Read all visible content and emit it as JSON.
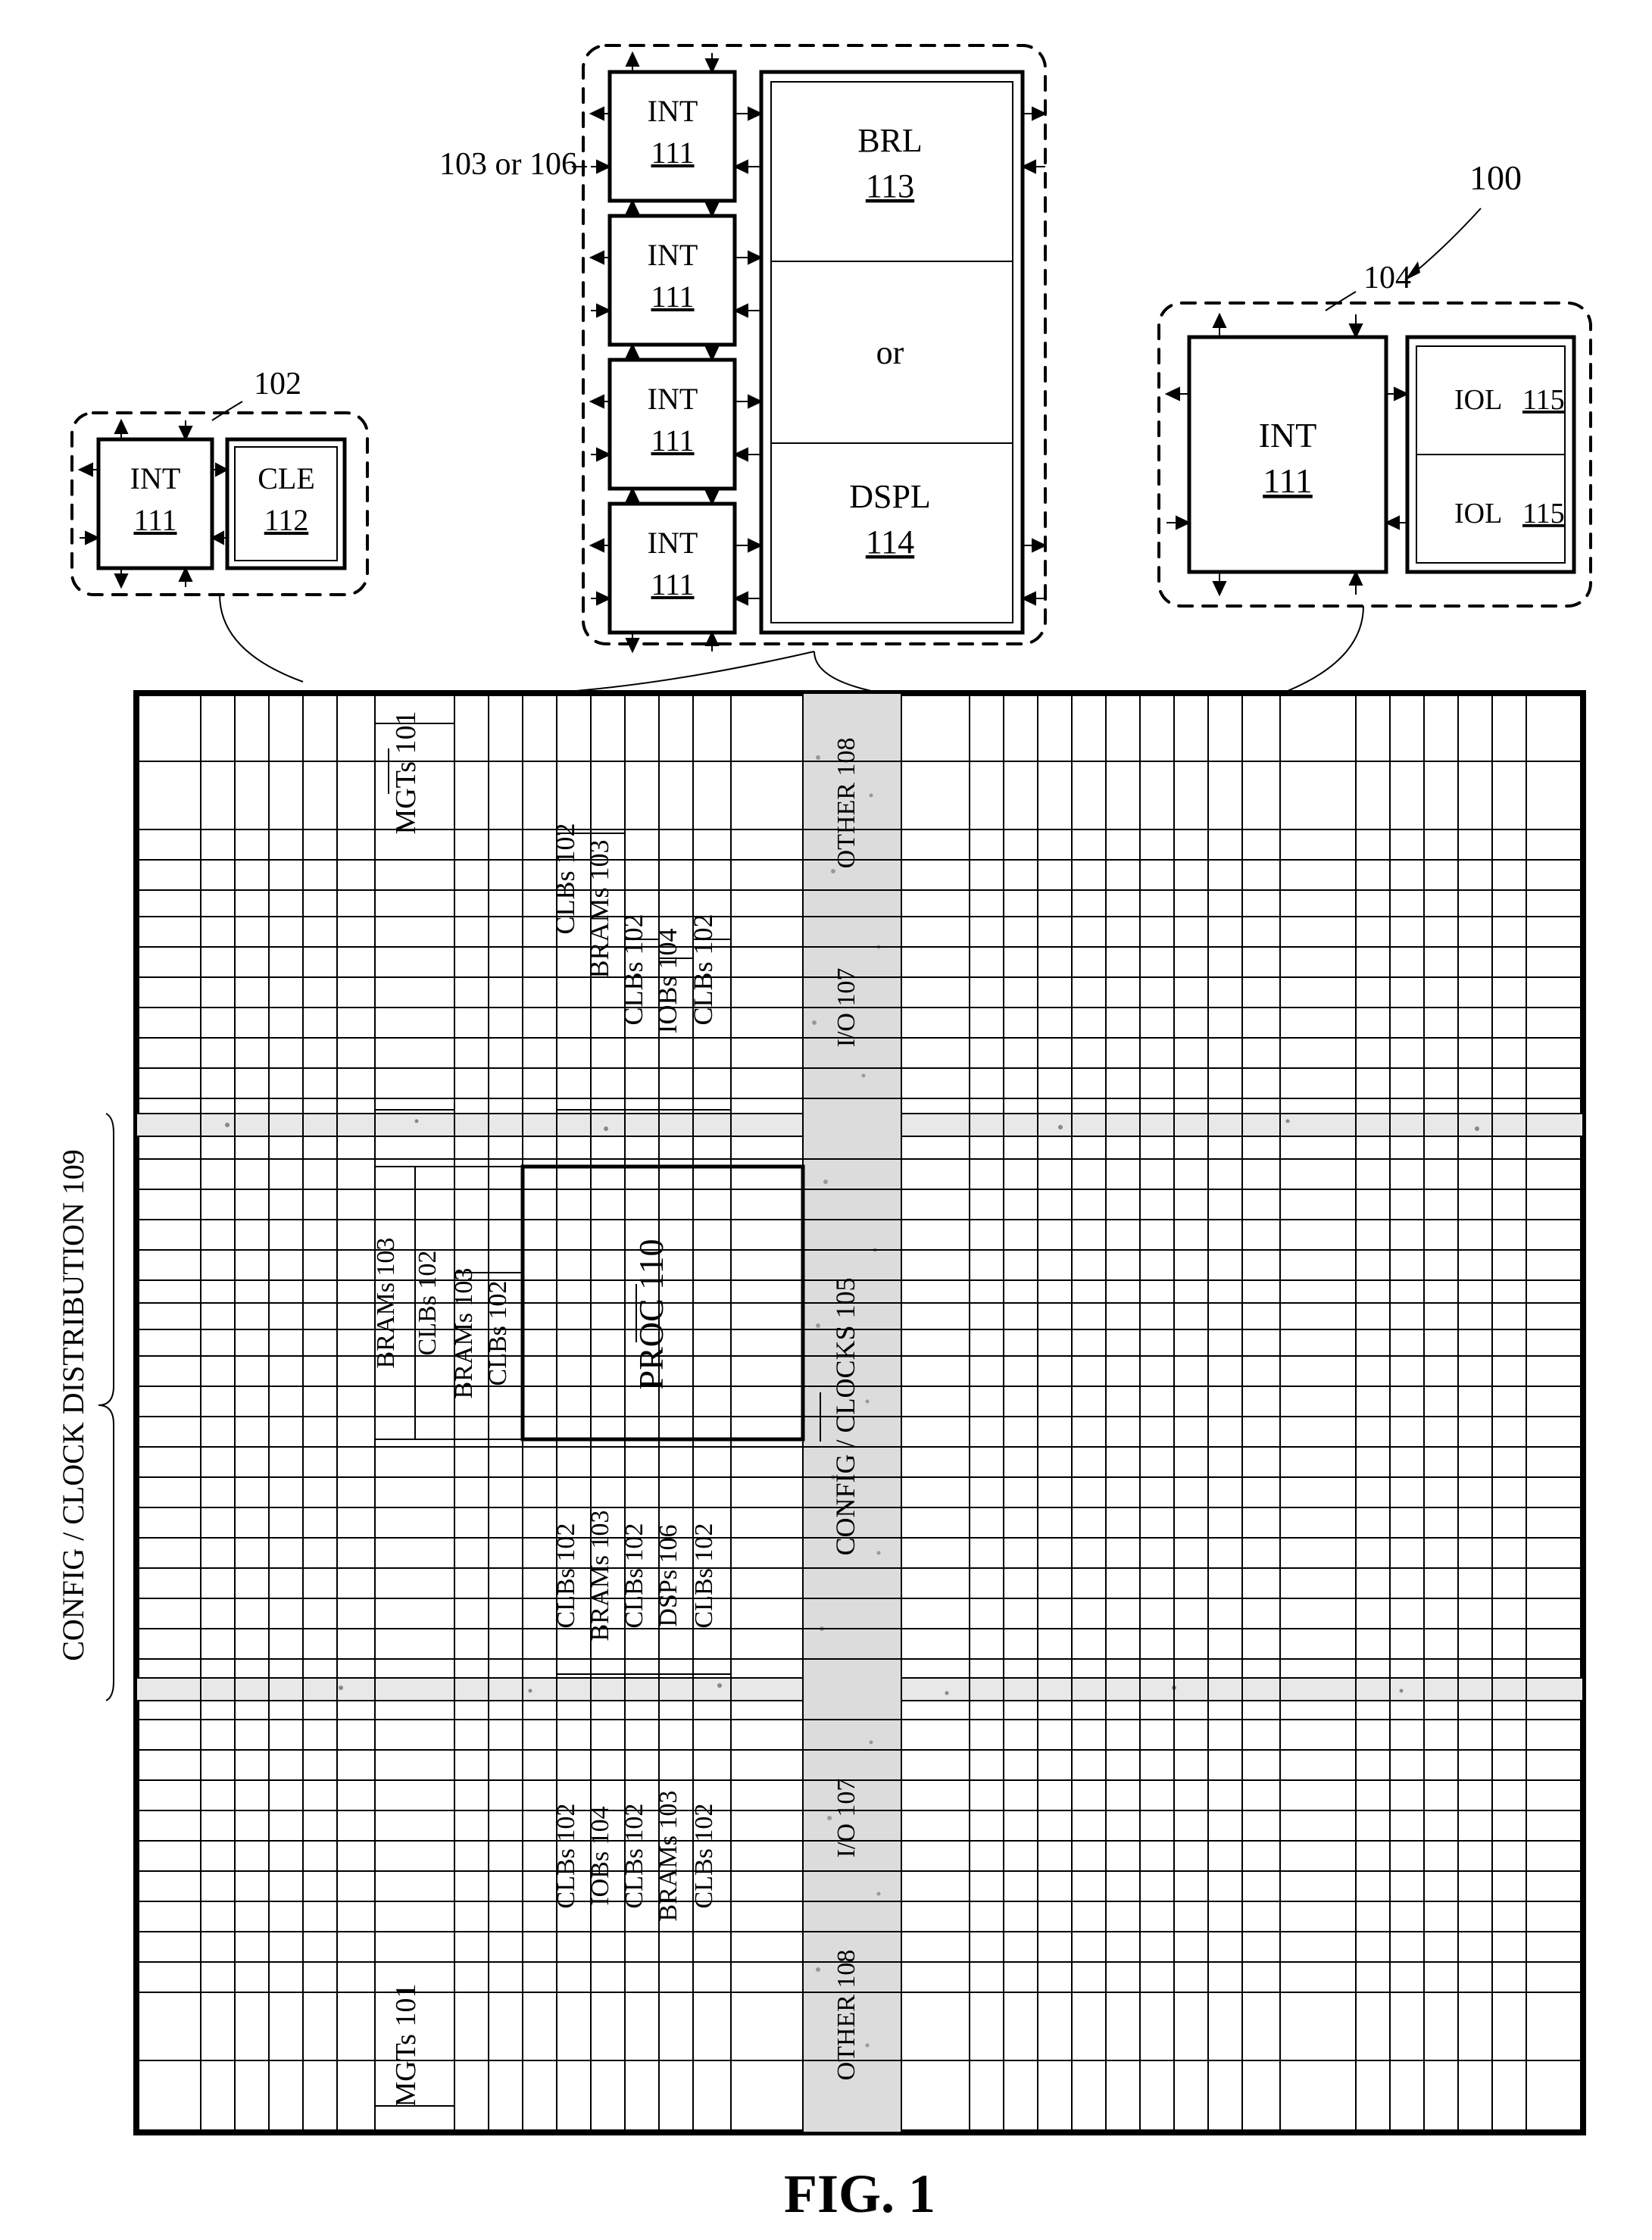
{
  "figure_label": "FIG. 1",
  "ref_100": "100",
  "callout_left": {
    "ref": "102",
    "int_label": "INT",
    "int_ref": "111",
    "cle_label": "CLE",
    "cle_ref": "112"
  },
  "callout_mid": {
    "ref": "103 or 106",
    "int_label": "INT",
    "int_ref": "111",
    "brl_label": "BRL",
    "brl_ref": "113",
    "or_label": "or",
    "dspl_label": "DSPL",
    "dspl_ref": "114"
  },
  "callout_right": {
    "ref": "104",
    "int_label": "INT",
    "int_ref": "111",
    "iol_label": "IOL",
    "iol_ref": "115"
  },
  "side_label": "CONFIG / CLOCK DISTRIBUTION 109",
  "left_upper": [
    "MGTs  101",
    "CLBs 102",
    "BRAMs 103",
    "CLBs 102",
    "IOBs 104",
    "CLBs 102"
  ],
  "left_mid_extra": [
    "BRAMs 103",
    "CLBs  102",
    "BRAMs 103",
    "CLBs  102"
  ],
  "proc_label": "PROC  110",
  "center_band": "CONFIG / CLOCKS  105",
  "right_upper": [
    "OTHER 108",
    "I/O  107"
  ],
  "right_lower": [
    "I/O  107",
    "OTHER 108"
  ],
  "left_lower": [
    "CLBs 102",
    "BRAMs 103",
    "CLBs 102",
    "DSPs 106",
    "CLBs 102",
    "IOBs 104",
    "CLBs 102",
    "BRAMs 103",
    "CLBs 102",
    "MGTs  101"
  ]
}
